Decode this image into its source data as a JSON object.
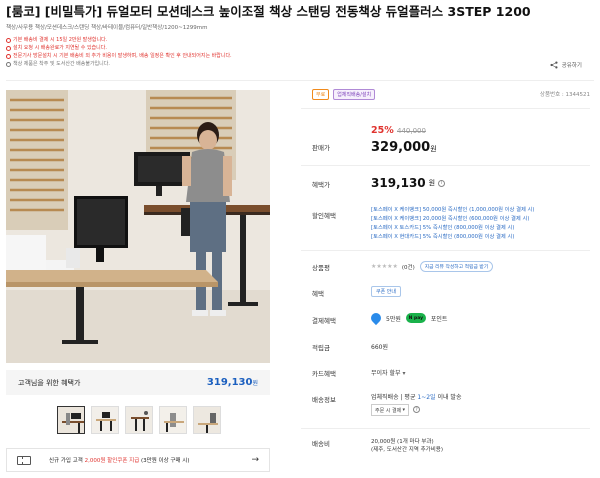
{
  "header": {
    "title": "[룸코] [비밀특가] 듀얼모터 모션데스크 높이조절 책상 스탠딩 전동책상 듀얼플러스 3STEP 1200",
    "breadcrumb": "책상/사무용 책상/모션데스크/스탠딩 책상/바테이블/컴퓨터/일반책상/1200~1299mm",
    "share_label": "공유하기"
  },
  "notices": [
    {
      "text": "기본 배송비 결제 시 15일 2만원 발생합니다.",
      "tone": "red"
    },
    {
      "text": "설치 요청 시 배송완료가 지연될 수 있습니다.",
      "tone": "red"
    },
    {
      "text": "전문기사 방문설치 시 기본 배송비 외 추가 비용이 발생하며, 배송 일정은 확인 후 안내되어지는 바랍니다.",
      "tone": "red"
    },
    {
      "text": "책상 제품은 착주 및 도서산간 배송불가입니다.",
      "tone": "gray"
    }
  ],
  "gallery": {
    "benefit_label": "고객님을 위한 혜택가",
    "benefit_amount": "319,130",
    "benefit_unit": "원",
    "thumb_count": 5,
    "coupon_prefix": "신규 가입 고객 ",
    "coupon_highlight": "2,000원 할인쿠폰 지급",
    "coupon_suffix": " (3만원 이상 구매 시)",
    "coupon_arrow": "→"
  },
  "product": {
    "badge_1": "무료",
    "badge_2": "업체직배송/설치",
    "product_no": "상품번호 : 1344521",
    "sale_label": "판매가",
    "discount": "25%",
    "original_price": "440,000",
    "price": "329,000",
    "price_unit": "원",
    "benefit_label": "혜택가",
    "benefit_price": "319,130",
    "benefit_unit": "원",
    "info_icon": "i",
    "card_label": "할인혜택",
    "card_lines": [
      "[토스페이 X 케이뱅크] 50,000원 즉시할인 (1,000,000원 이상 결제 시)",
      "[토스페이 X 케이뱅크] 20,000원 즉시할인 (600,000원 이상 결제 시)",
      "[토스페이 X 토스카드] 5% 즉시할인 (800,000원 이상 결제 시)",
      "[토스페이 X 현대카드] 5% 즉시할인 (800,000원 이상 결제 시)"
    ],
    "rating_label": "상품평",
    "stars": "★★★★★",
    "review_count": "(0건)",
    "review_pill": "지금 리뷰 작성하고 적립금 받기",
    "benefit2_label": "혜택",
    "benefit2_button": "쿠폰 안내",
    "pay_label": "결제혜택",
    "pay_1": "5만원",
    "pay_np_logo": "N pay",
    "pay_2": "포인트",
    "points_label": "적립금",
    "points_value": "660원",
    "card_benefit_label": "카드혜택",
    "card_benefit_value": "무이자 할부",
    "card_benefit_chev": "▾",
    "delivery_label": "배송정보",
    "delivery_prefix": "업체직배송 | 평균 ",
    "delivery_highlight": "1~2일",
    "delivery_suffix": " 이내 발송",
    "delivery_select": "주문 시 결제",
    "select_chev": "▾",
    "help_icon": "?",
    "ship_fee_label": "배송비",
    "ship_fee_line1": "20,000원 (1개 마다 부과)",
    "ship_fee_line2": "(제주, 도서산간 지역 추가비용)"
  }
}
